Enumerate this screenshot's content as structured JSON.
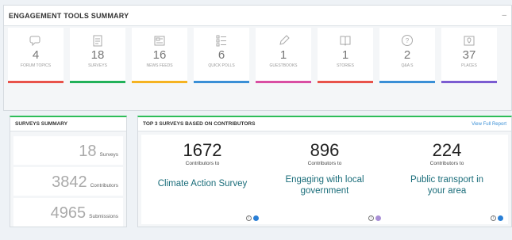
{
  "main": {
    "title": "ENGAGEMENT TOOLS SUMMARY",
    "collapse": "–"
  },
  "tools": [
    {
      "count": "4",
      "label": "FORUM TOPICS",
      "icon": "chat-icon",
      "color": "#e8534b"
    },
    {
      "count": "18",
      "label": "SURVEYS",
      "icon": "clipboard-icon",
      "color": "#22b15a"
    },
    {
      "count": "16",
      "label": "NEWS FEEDS",
      "icon": "newspaper-icon",
      "color": "#f5b322"
    },
    {
      "count": "6",
      "label": "QUICK POLLS",
      "icon": "list-icon",
      "color": "#3a8fd6"
    },
    {
      "count": "1",
      "label": "GUESTBOOKS",
      "icon": "pencil-icon",
      "color": "#d94ea3"
    },
    {
      "count": "1",
      "label": "STORIES",
      "icon": "book-icon",
      "color": "#e8534b"
    },
    {
      "count": "2",
      "label": "Q&A S",
      "icon": "question-icon",
      "color": "#3a8fd6"
    },
    {
      "count": "37",
      "label": "PLACES",
      "icon": "map-pin-icon",
      "color": "#7b5cd1"
    }
  ],
  "surveys_summary": {
    "title": "SURVEYS SUMMARY",
    "rows": [
      {
        "num": "18",
        "label": "Surveys"
      },
      {
        "num": "3842",
        "label": "Contributors"
      },
      {
        "num": "4965",
        "label": "Submissions"
      }
    ]
  },
  "top3": {
    "title": "TOP 3 SURVEYS BASED ON CONTRIBUTORS",
    "view_link": "View Full Report",
    "cards": [
      {
        "num": "1672",
        "sub": "Contributors to",
        "name": "Climate Action Survey",
        "dot": "#2a7fd6"
      },
      {
        "num": "896",
        "sub": "Contributors to",
        "name": "Engaging with local government",
        "dot": "#a98fd6"
      },
      {
        "num": "224",
        "sub": "Contributors to",
        "name": "Public transport in your area",
        "dot": "#2a7fd6"
      }
    ]
  }
}
